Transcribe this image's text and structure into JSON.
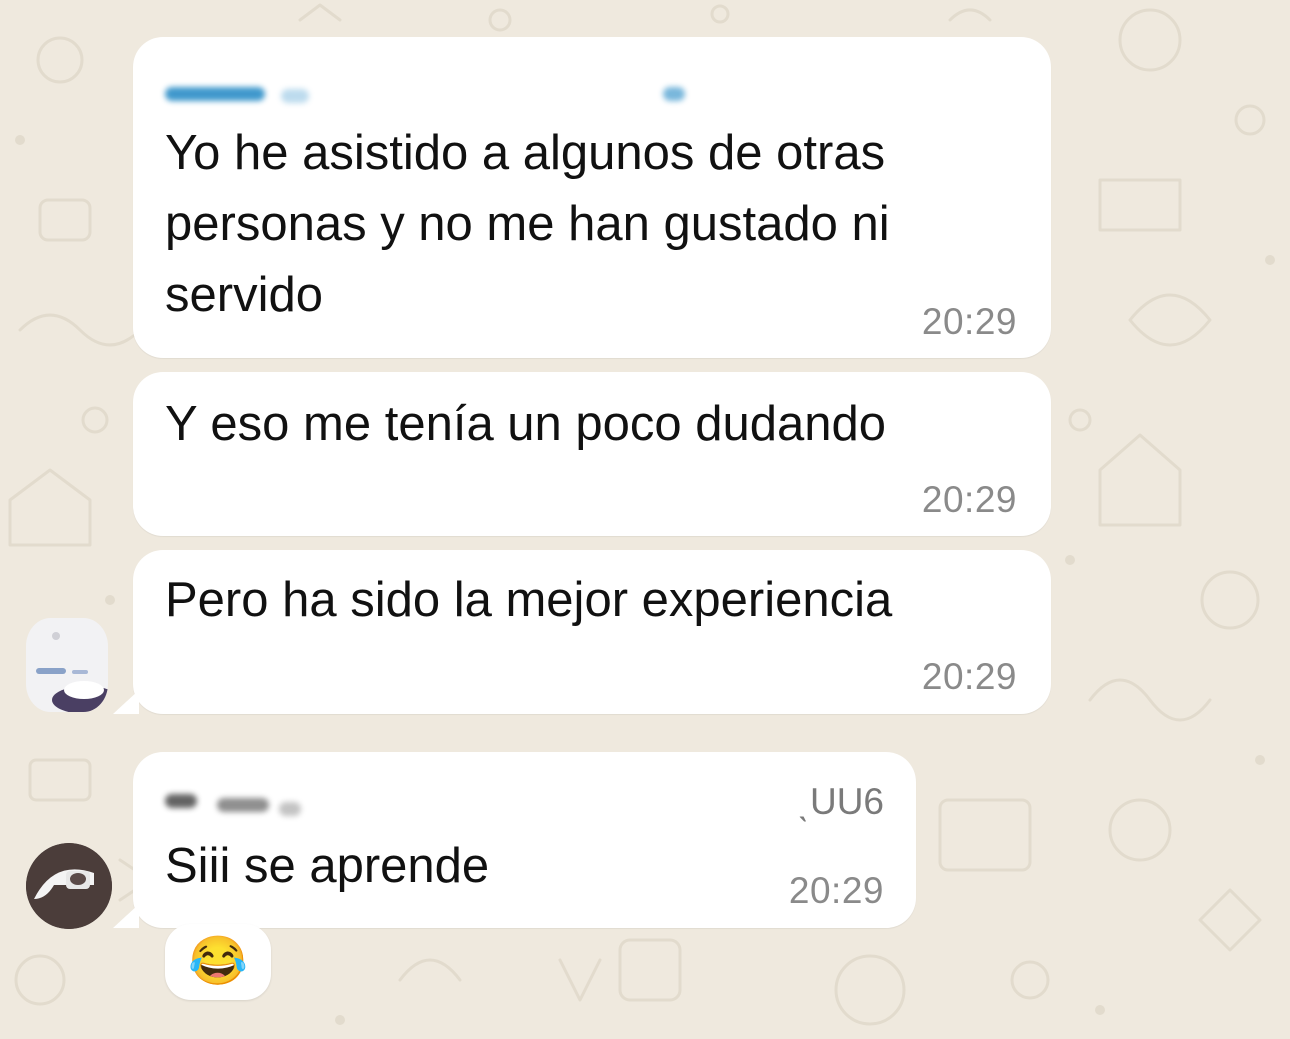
{
  "chat": {
    "messages": [
      {
        "text": "Yo he asistido a algunos de otras\npersonas y no me han gustado ni\nservido",
        "time": "20:29"
      },
      {
        "text": "Y eso me tenía un poco dudando",
        "time": "20:29"
      },
      {
        "text": "Pero ha sido la mejor experiencia",
        "time": "20:29"
      },
      {
        "phone_fragment": "ˎUU6",
        "text": "Siii se aprende",
        "time": "20:29",
        "reaction": "😂"
      }
    ]
  },
  "colors": {
    "wallpaper": "#efe9de",
    "bubble": "#ffffff",
    "sender_name": "#1f87c4",
    "timestamp": "#8a8a8a"
  }
}
